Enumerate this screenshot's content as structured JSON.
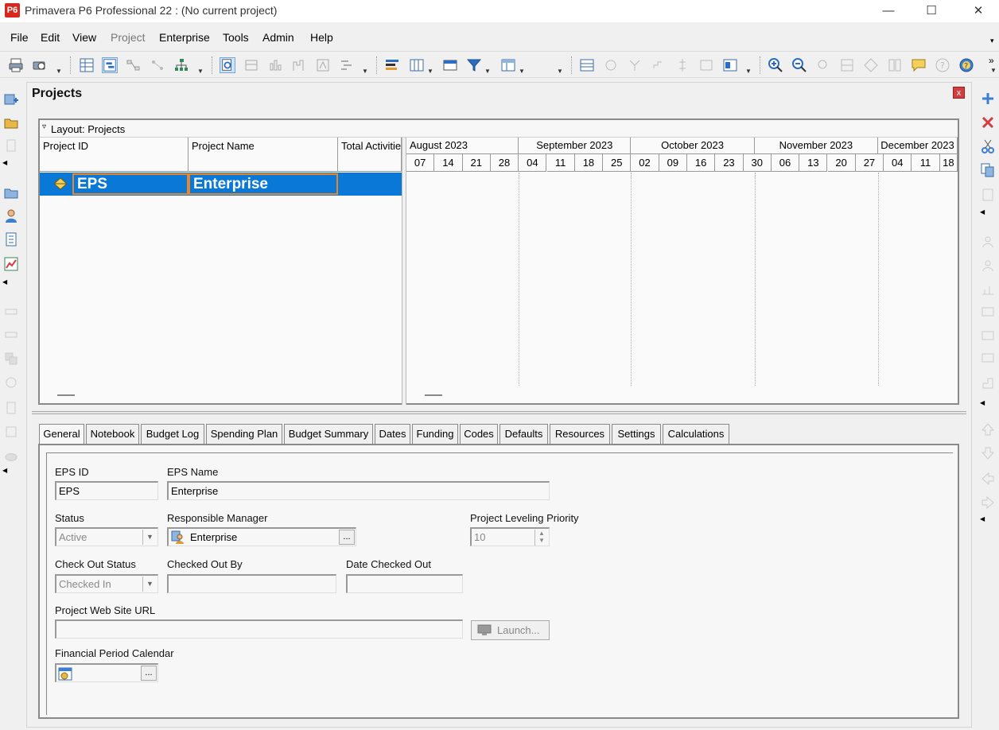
{
  "app": {
    "logo": "P6",
    "title": "Primavera P6 Professional 22 : (No current project)"
  },
  "menu": {
    "items": [
      {
        "label": "File",
        "enabled": true
      },
      {
        "label": "Edit",
        "enabled": true
      },
      {
        "label": "View",
        "enabled": true
      },
      {
        "label": "Project",
        "enabled": false
      },
      {
        "label": "Enterprise",
        "enabled": true
      },
      {
        "label": "Tools",
        "enabled": true
      },
      {
        "label": "Admin",
        "enabled": true
      },
      {
        "label": "Help",
        "enabled": true
      }
    ]
  },
  "window": {
    "title": "Projects",
    "close_glyph": "x"
  },
  "layout": {
    "label": "Layout: Projects"
  },
  "table": {
    "columns": [
      "Project ID",
      "Project Name",
      "Total Activitie"
    ],
    "rows": [
      {
        "id": "EPS",
        "name": "Enterprise"
      }
    ]
  },
  "gantt": {
    "months": [
      "August 2023",
      "September 2023",
      "October 2023",
      "November 2023",
      "December 2023"
    ],
    "weeks": [
      "07",
      "14",
      "21",
      "28",
      "04",
      "11",
      "18",
      "25",
      "02",
      "09",
      "16",
      "23",
      "30",
      "06",
      "13",
      "20",
      "27",
      "04",
      "11",
      "18"
    ]
  },
  "tabs": [
    "General",
    "Notebook",
    "Budget Log",
    "Spending Plan",
    "Budget Summary",
    "Dates",
    "Funding",
    "Codes",
    "Defaults",
    "Resources",
    "Settings",
    "Calculations"
  ],
  "general": {
    "eps_id_label": "EPS ID",
    "eps_id_value": "EPS",
    "eps_name_label": "EPS Name",
    "eps_name_value": "Enterprise",
    "status_label": "Status",
    "status_value": "Active",
    "manager_label": "Responsible Manager",
    "manager_value": "Enterprise",
    "leveling_label": "Project Leveling Priority",
    "leveling_value": "10",
    "checkout_status_label": "Check Out Status",
    "checkout_status_value": "Checked In",
    "checked_out_by_label": "Checked Out By",
    "date_checked_out_label": "Date Checked Out",
    "url_label": "Project Web Site URL",
    "launch_label": "Launch...",
    "fin_calendar_label": "Financial Period Calendar",
    "ellipsis": "..."
  },
  "colors": {
    "selection": "#0a78d7",
    "logo": "#d8281e",
    "close": "#d33d3d"
  }
}
